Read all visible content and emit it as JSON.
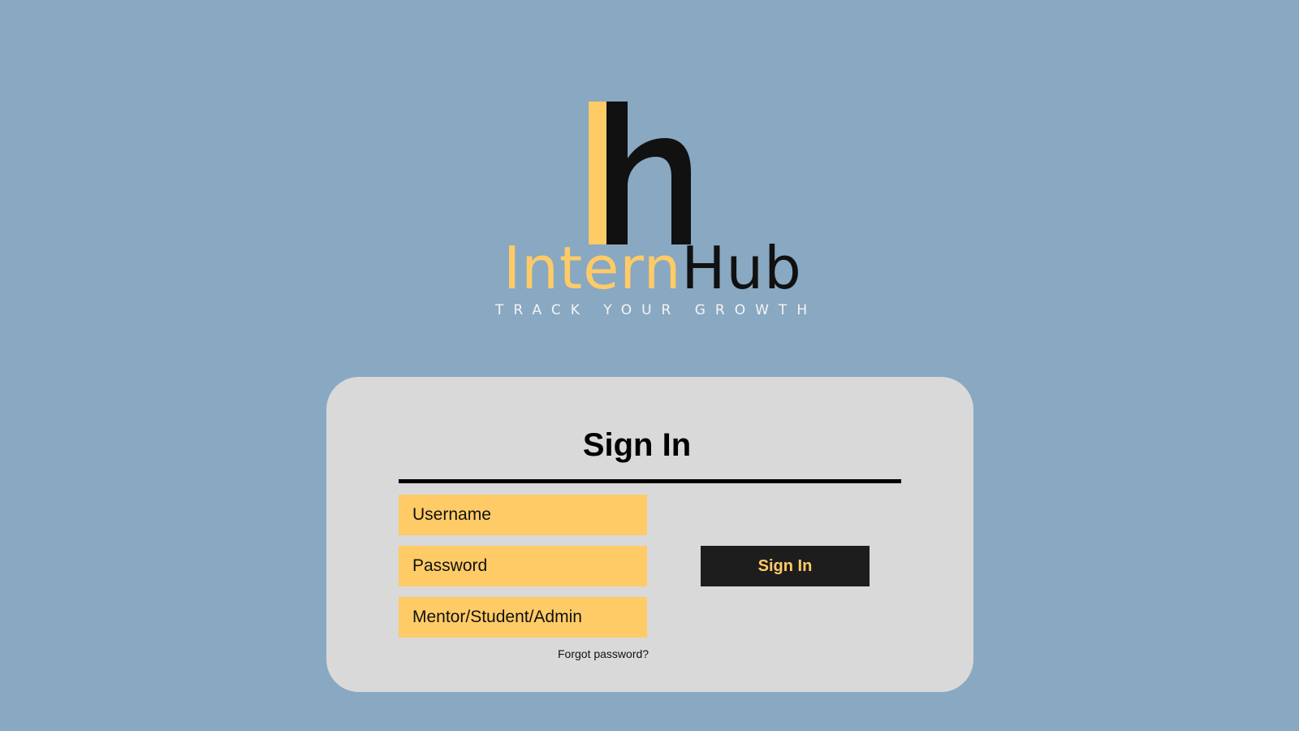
{
  "colors": {
    "background": "#89a8c2",
    "accent": "#ffcb66",
    "card": "#d9d9d9",
    "button": "#1d1d1d",
    "text": "#111111"
  },
  "logo": {
    "name_part_1": "Intern",
    "name_part_2": "Hub",
    "tagline": "TRACK YOUR GROWTH",
    "icon": "h-letter-logo-icon"
  },
  "signin": {
    "title": "Sign In",
    "username_placeholder": "Username",
    "password_placeholder": "Password",
    "role_placeholder": "Mentor/Student/Admin",
    "submit_label": "Sign In",
    "forgot_label": "Forgot password?"
  }
}
